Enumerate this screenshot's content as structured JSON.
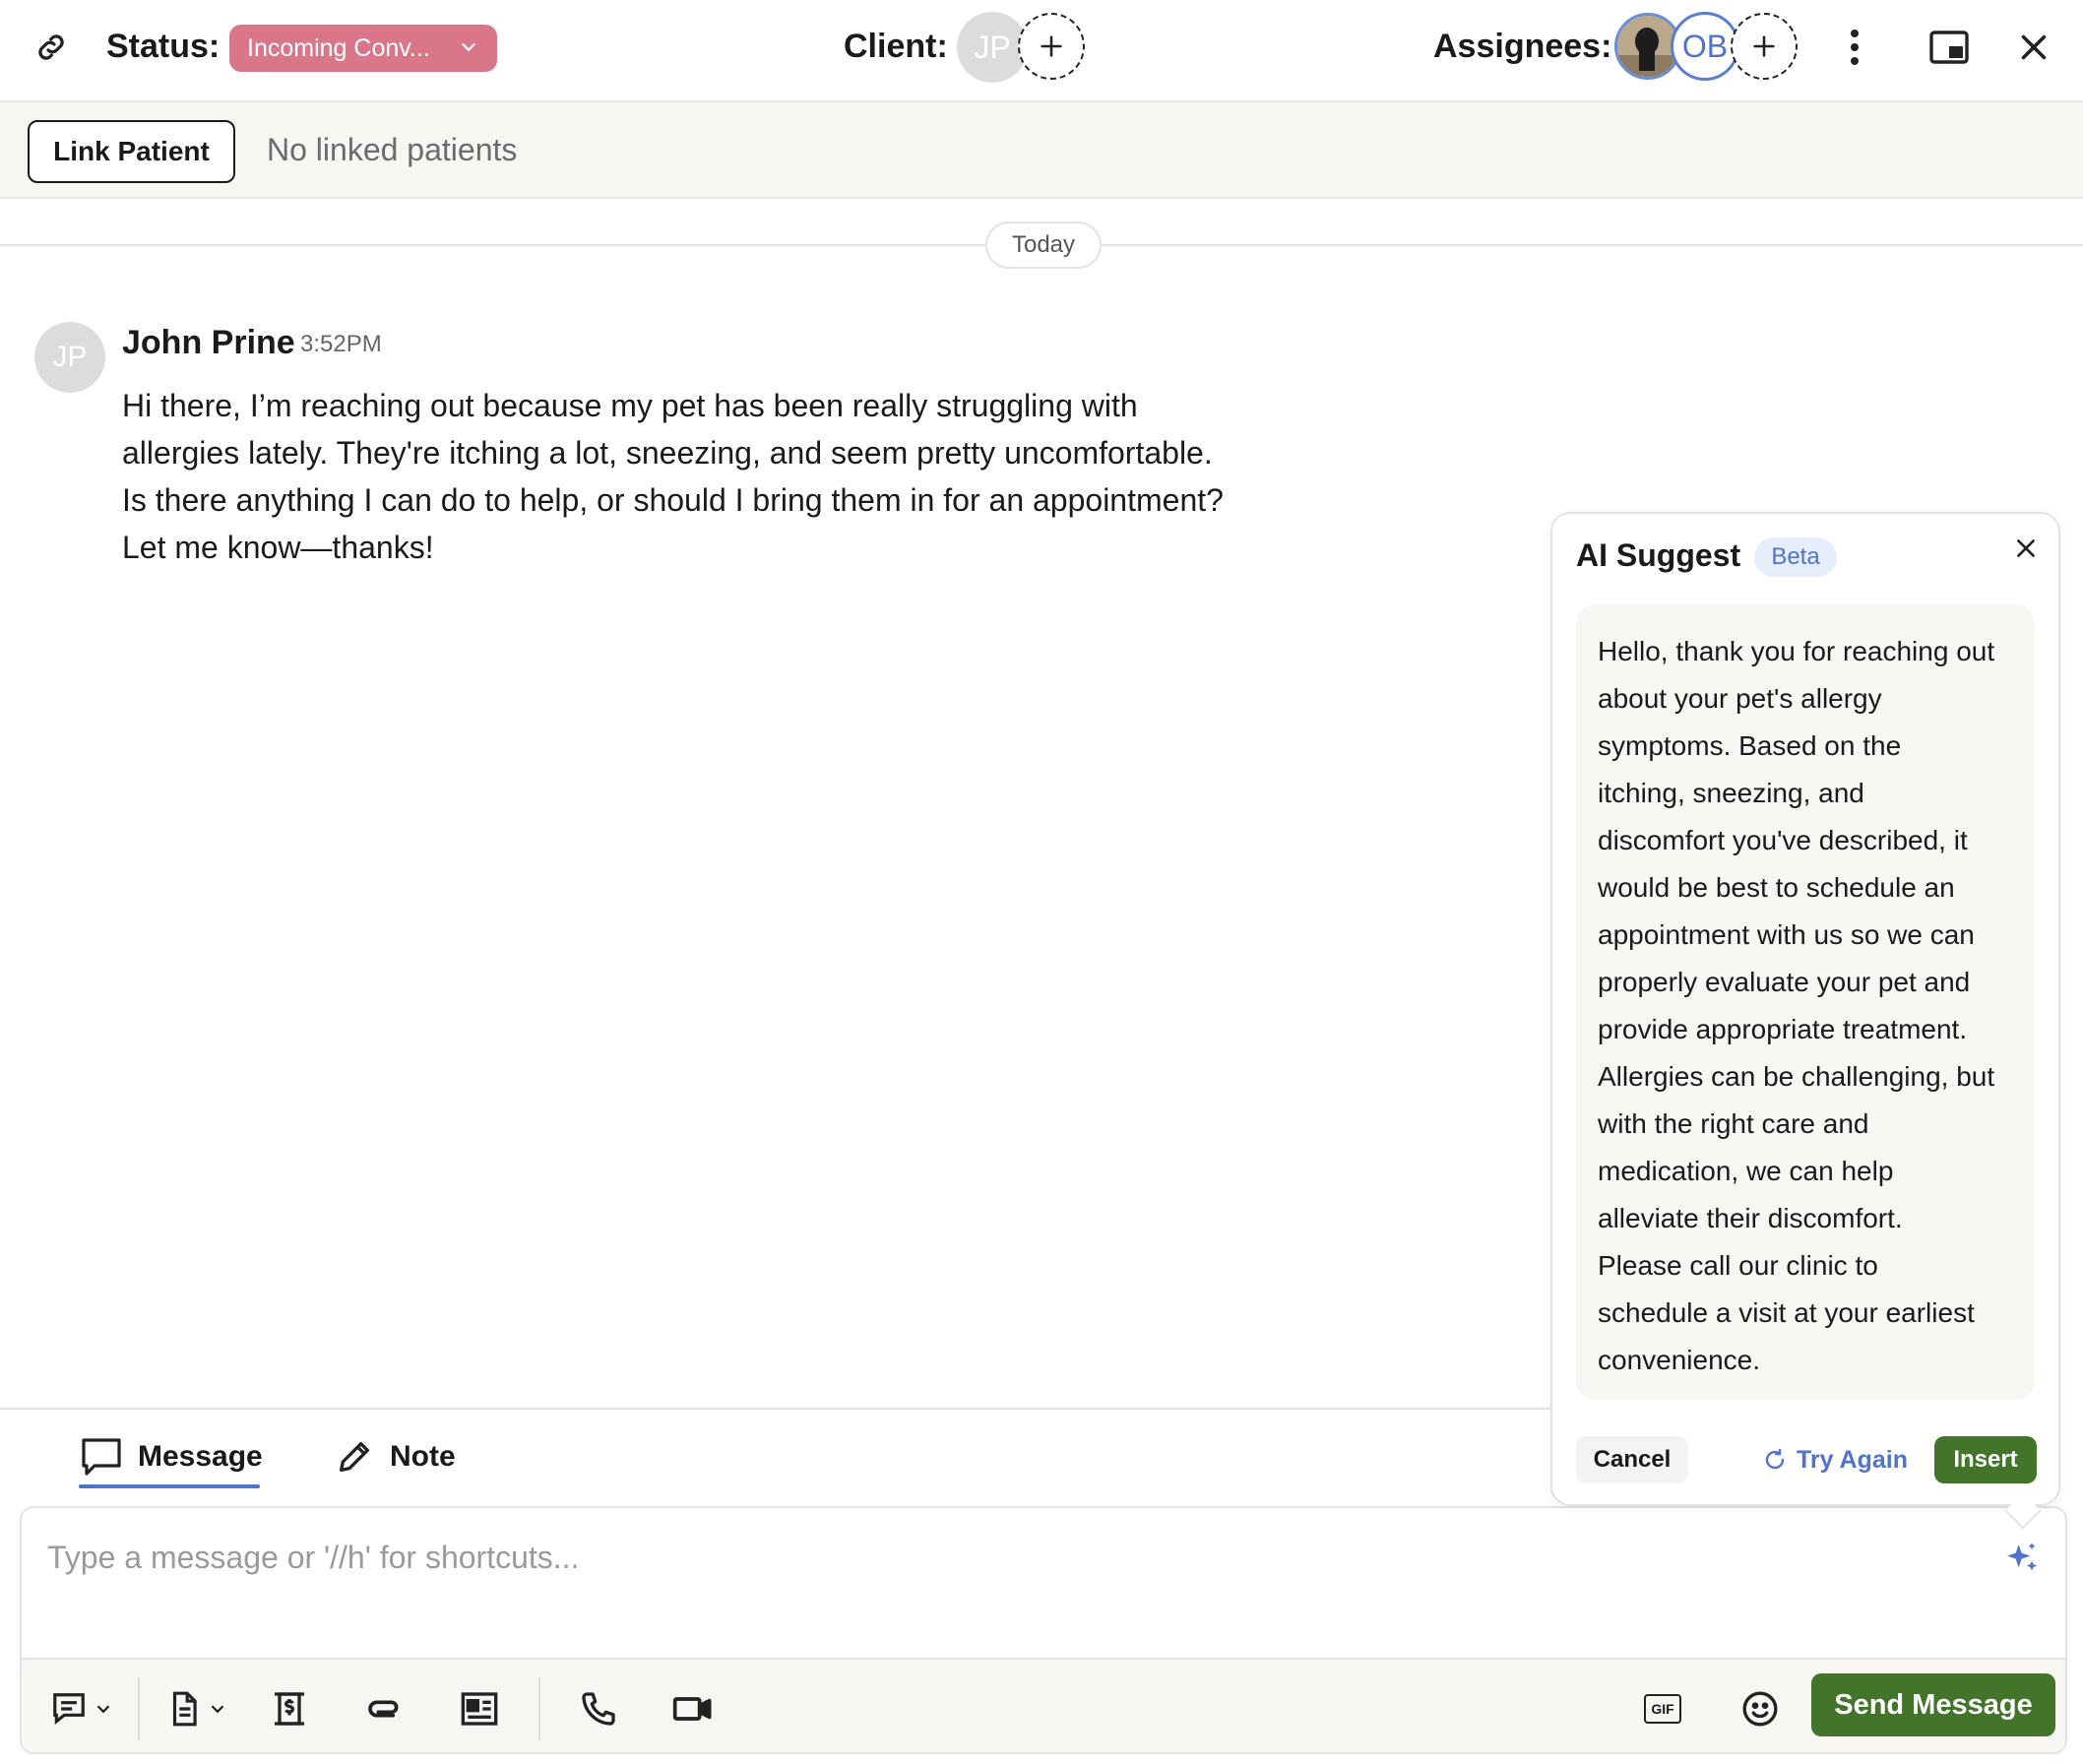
{
  "header": {
    "status_label": "Status:",
    "status_value": "Incoming Conv...",
    "client_label": "Client:",
    "client_initials": "JP",
    "assignees_label": "Assignees:",
    "assignee_initials": "OB"
  },
  "link_bar": {
    "link_button": "Link Patient",
    "no_linked_text": "No linked patients"
  },
  "conversation": {
    "date_divider": "Today",
    "message": {
      "avatar_initials": "JP",
      "sender": "John Prine",
      "time": "3:52PM",
      "lines": [
        "Hi there, I’m reaching out because my pet has been really struggling with",
        "allergies lately. They're itching a lot, sneezing, and seem pretty uncomfortable.",
        "Is there anything I can do to help, or should I bring them in for an appointment?",
        "Let me know—thanks!"
      ]
    }
  },
  "ai_suggest": {
    "title": "AI Suggest",
    "badge": "Beta",
    "lines": [
      "Hello, thank you for reaching out",
      "about your pet's allergy",
      "symptoms. Based on the",
      "itching, sneezing, and",
      "discomfort you've described, it",
      "would be best to schedule an",
      "appointment with us so we can",
      "properly evaluate your pet and",
      "provide appropriate treatment.",
      "Allergies can be challenging, but",
      "with the right care and",
      "medication, we can help",
      "alleviate their discomfort.",
      "Please call our clinic to",
      "schedule a visit at your earliest",
      "convenience."
    ],
    "cancel_label": "Cancel",
    "try_again_label": "Try Again",
    "insert_label": "Insert"
  },
  "composer": {
    "tabs": [
      {
        "label": "Message",
        "icon": "chat-bubble-icon",
        "active": true
      },
      {
        "label": "Note",
        "icon": "pencil-icon",
        "active": false
      }
    ],
    "placeholder": "Type a message or '//h' for shortcuts...",
    "send_label": "Send Message",
    "gif_label": "GIF"
  },
  "colors": {
    "status_pill": "#d9768a",
    "accent_blue": "#4f74c8",
    "primary_green": "#42752a"
  }
}
